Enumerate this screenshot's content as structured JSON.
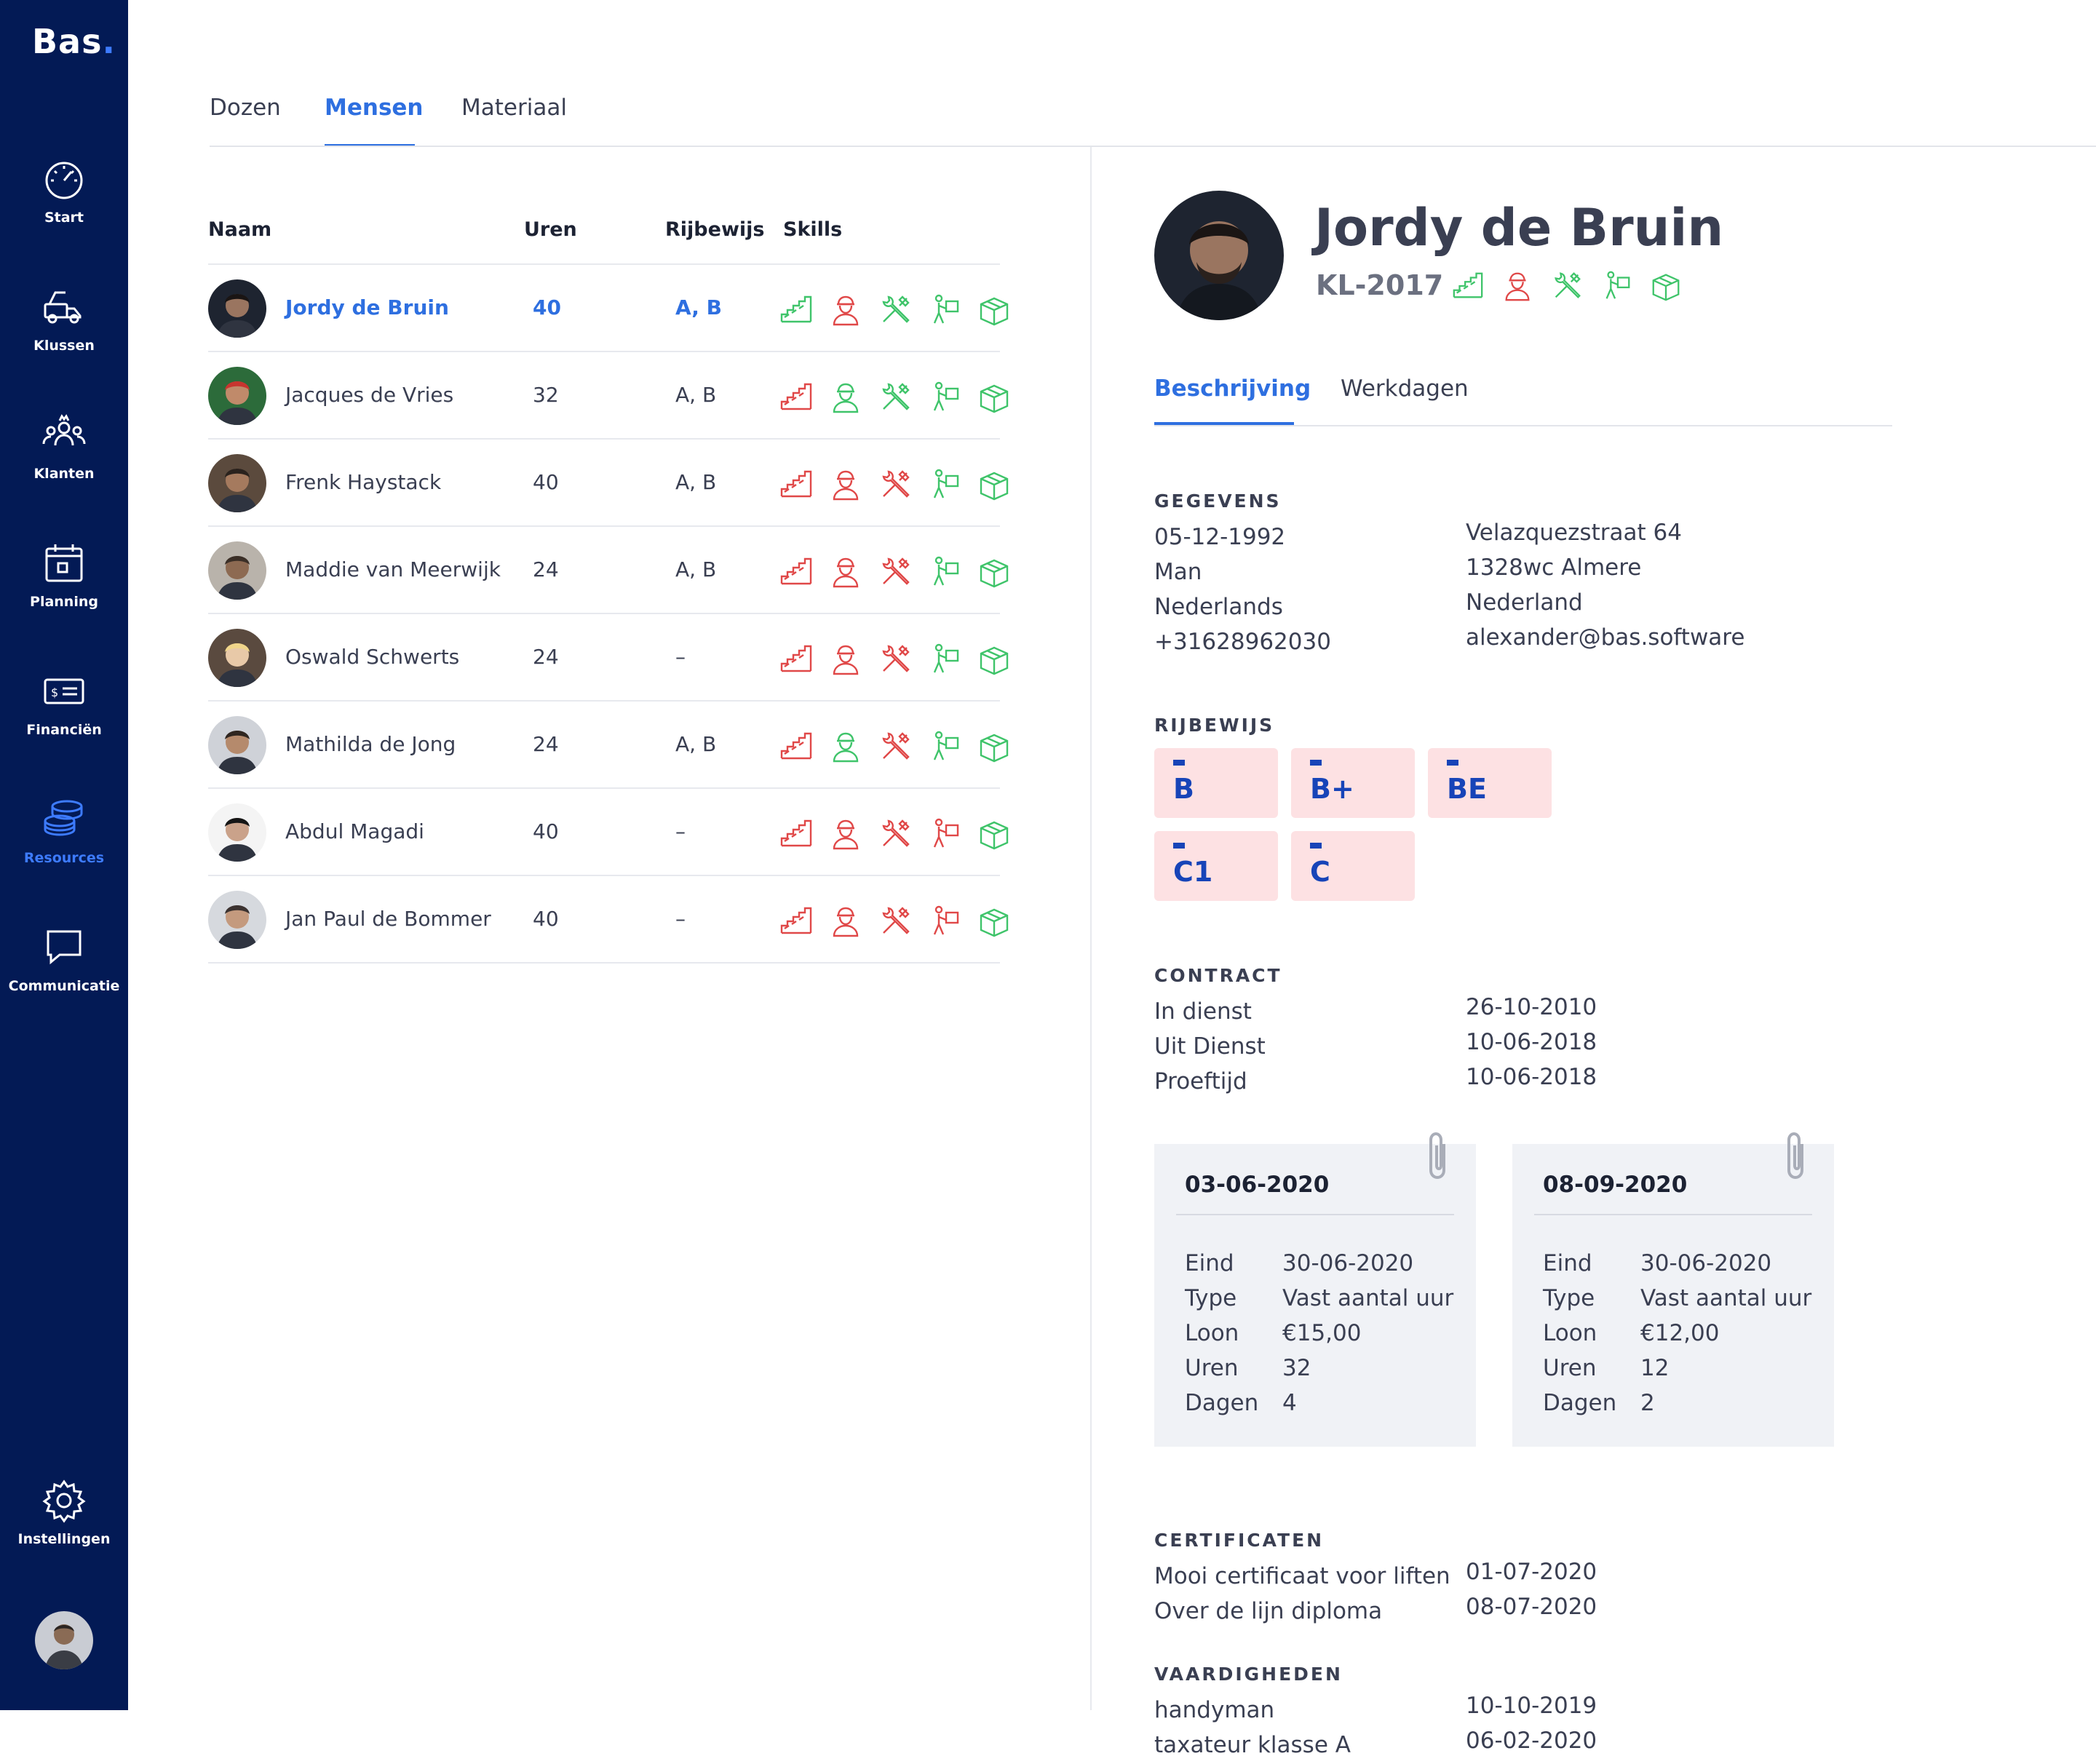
{
  "app": {
    "logo_text": "Bas",
    "logo_dot": ".",
    "brand_color": "#031a55",
    "accent_color": "#2e6fe0"
  },
  "sidebar": {
    "items": [
      {
        "label": "Start",
        "icon": "speedometer-icon"
      },
      {
        "label": "Klussen",
        "icon": "truck-icon"
      },
      {
        "label": "Klanten",
        "icon": "people-icon"
      },
      {
        "label": "Planning",
        "icon": "calendar-icon"
      },
      {
        "label": "Financiën",
        "icon": "money-card-icon"
      },
      {
        "label": "Resources",
        "icon": "database-icon",
        "active": true
      },
      {
        "label": "Communicatie",
        "icon": "chat-icon"
      }
    ],
    "settings_label": "Instellingen"
  },
  "tabs": [
    {
      "label": "Dozen"
    },
    {
      "label": "Mensen",
      "active": true
    },
    {
      "label": "Materiaal"
    }
  ],
  "table": {
    "headers": {
      "naam": "Naam",
      "uren": "Uren",
      "rijbewijs": "Rijbewijs",
      "skills": "Skills"
    },
    "skill_icons": [
      "staircase-icon",
      "worker-icon",
      "tools-icon",
      "person-lifting-icon",
      "box-icon"
    ],
    "rows": [
      {
        "naam": "Jordy de Bruin",
        "uren": "40",
        "rijbewijs": "A, B",
        "skills": [
          "ok",
          "no",
          "ok",
          "ok",
          "ok"
        ],
        "active": true
      },
      {
        "naam": "Jacques de Vries",
        "uren": "32",
        "rijbewijs": "A, B",
        "skills": [
          "no",
          "ok",
          "ok",
          "ok",
          "ok"
        ]
      },
      {
        "naam": "Frenk Haystack",
        "uren": "40",
        "rijbewijs": "A, B",
        "skills": [
          "no",
          "no",
          "no",
          "ok",
          "ok"
        ]
      },
      {
        "naam": "Maddie van Meerwijk",
        "uren": "24",
        "rijbewijs": "A, B",
        "skills": [
          "no",
          "no",
          "no",
          "ok",
          "ok"
        ]
      },
      {
        "naam": "Oswald Schwerts",
        "uren": "24",
        "rijbewijs": "–",
        "skills": [
          "no",
          "no",
          "no",
          "ok",
          "ok"
        ]
      },
      {
        "naam": "Mathilda de Jong",
        "uren": "24",
        "rijbewijs": "A, B",
        "skills": [
          "no",
          "ok",
          "no",
          "ok",
          "ok"
        ]
      },
      {
        "naam": "Abdul Magadi",
        "uren": "40",
        "rijbewijs": "–",
        "skills": [
          "no",
          "no",
          "no",
          "no",
          "ok"
        ]
      },
      {
        "naam": "Jan Paul de Bommer",
        "uren": "40",
        "rijbewijs": "–",
        "skills": [
          "no",
          "no",
          "no",
          "no",
          "ok"
        ]
      }
    ],
    "skill_colors": {
      "ok": "#3fc46a",
      "no": "#e04848"
    }
  },
  "detail": {
    "name": "Jordy de Bruin",
    "code": "KL-2017",
    "skills": [
      "ok",
      "no",
      "ok",
      "ok",
      "ok"
    ],
    "tabs": [
      {
        "label": "Beschrijving",
        "active": true
      },
      {
        "label": "Werkdagen"
      }
    ],
    "gegevens": {
      "title": "GEGEVENS",
      "left": [
        "05-12-1992",
        "Man",
        "Nederlands",
        "+31628962030"
      ],
      "right": [
        "Velazquezstraat 64",
        "1328wc Almere",
        "Nederland",
        "alexander@bas.software"
      ]
    },
    "rijbewijs": {
      "title": "RIJBEWIJS",
      "items": [
        "B",
        "B+",
        "BE",
        "C1",
        "C"
      ]
    },
    "contract": {
      "title": "CONTRACT",
      "rows": [
        {
          "label": "In dienst",
          "value": "26-10-2010"
        },
        {
          "label": "Uit Dienst",
          "value": "10-06-2018"
        },
        {
          "label": "Proeftijd",
          "value": "10-06-2018"
        }
      ],
      "cards": [
        {
          "date": "03-06-2020",
          "rows": [
            {
              "k": "Eind",
              "v": "30-06-2020"
            },
            {
              "k": "Type",
              "v": "Vast aantal uur"
            },
            {
              "k": "Loon",
              "v": "€15,00"
            },
            {
              "k": "Uren",
              "v": "32"
            },
            {
              "k": "Dagen",
              "v": "4"
            }
          ]
        },
        {
          "date": "08-09-2020",
          "rows": [
            {
              "k": "Eind",
              "v": "30-06-2020"
            },
            {
              "k": "Type",
              "v": "Vast aantal uur"
            },
            {
              "k": "Loon",
              "v": "€12,00"
            },
            {
              "k": "Uren",
              "v": "12"
            },
            {
              "k": "Dagen",
              "v": "2"
            }
          ]
        }
      ]
    },
    "certificaten": {
      "title": "CERTIFICATEN",
      "rows": [
        {
          "label": "Mooi certificaat voor liften",
          "value": "01-07-2020"
        },
        {
          "label": "Over de lijn diploma",
          "value": "08-07-2020"
        }
      ]
    },
    "vaardigheden": {
      "title": "VAARDIGHEDEN",
      "rows": [
        {
          "label": "handyman",
          "value": "10-10-2019"
        },
        {
          "label": "taxateur klasse A",
          "value": "06-02-2020"
        }
      ]
    }
  }
}
